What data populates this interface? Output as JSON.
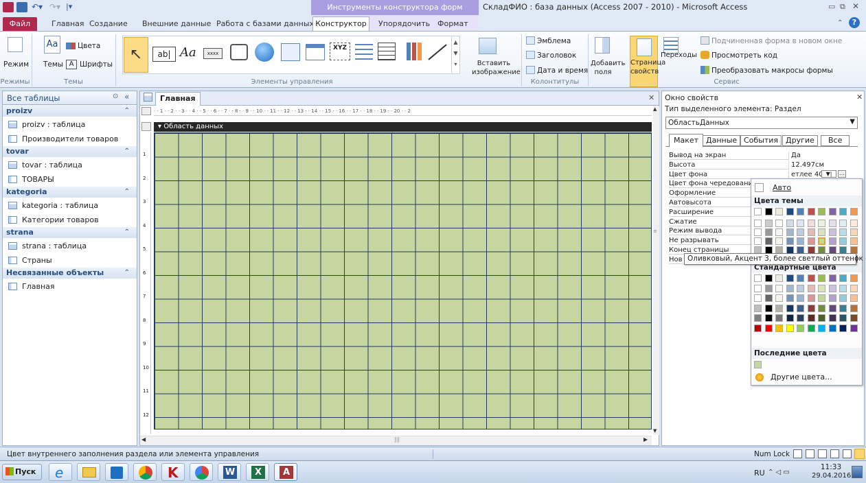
{
  "window": {
    "context_title": "Инструменты конструктора форм",
    "title": "СкладФИО : база данных (Access 2007 - 2010)  -  Microsoft Access"
  },
  "tabs": {
    "file": "Файл",
    "items": [
      "Главная",
      "Создание",
      "Внешние данные",
      "Работа с базами данных"
    ],
    "active": "Конструктор",
    "ctx_items": [
      "Упорядочить",
      "Формат"
    ]
  },
  "ribbon": {
    "mode": "Режим",
    "themes": "Темы",
    "colors": "Цвета",
    "fonts": "Шрифты",
    "insert_image": "Вставить изображение",
    "emblem": "Эмблема",
    "header": "Заголовок",
    "datetime": "Дата и время",
    "add_fields": "Добавить поля",
    "prop_sheet": "Страница свойств",
    "transitions": "Переходы",
    "subform_new": "Подчиненная форма в новом окне",
    "view_code": "Просмотреть код",
    "convert_macros": "Преобразовать макросы формы",
    "groups": {
      "modes": "Режимы",
      "themes": "Темы",
      "controls": "Элементы управления",
      "header_footer": "Колонтитулы",
      "service": "Сервис"
    }
  },
  "nav": {
    "title": "Все таблицы",
    "groups": [
      {
        "name": "proizv",
        "items": [
          {
            "label": "proizv : таблица",
            "kind": "table"
          },
          {
            "label": "Производители товаров",
            "kind": "form"
          }
        ]
      },
      {
        "name": "tovar",
        "items": [
          {
            "label": "tovar : таблица",
            "kind": "table"
          },
          {
            "label": "ТОВАРЫ",
            "kind": "form"
          }
        ]
      },
      {
        "name": "kategoria",
        "items": [
          {
            "label": "kategoria : таблица",
            "kind": "table"
          },
          {
            "label": "Категории товаров",
            "kind": "form"
          }
        ]
      },
      {
        "name": "strana",
        "items": [
          {
            "label": "strana : таблица",
            "kind": "table"
          },
          {
            "label": "Страны",
            "kind": "form"
          }
        ]
      },
      {
        "name": "Несвязанные объекты",
        "items": [
          {
            "label": "Главная",
            "kind": "form"
          }
        ]
      }
    ]
  },
  "document": {
    "tab": "Главная",
    "section": "Область данных",
    "vruler": [
      "1",
      "2",
      "3",
      "4",
      "5",
      "6",
      "7",
      "8",
      "9",
      "10",
      "11",
      "12"
    ],
    "hruler": "· · 1 · · 2 · · 3 · · 4 · · 5 · · 6 · · 7 · · 8 · · 9 · · 10 · · 11 · · 12 · · 13 · · 14 · · 15 · · 16 · · 17 · · 18 · · 19 · · 20 · · 2",
    "fill": "#c5d6a0"
  },
  "props": {
    "title": "Окно свойств",
    "selection_type": "Тип выделенного элемента:  Раздел",
    "object": "ОбластьДанных",
    "tabs": [
      "Макет",
      "Данные",
      "События",
      "Другие",
      "Все"
    ],
    "rows": [
      {
        "name": "Вывод на экран",
        "value": "Да"
      },
      {
        "name": "Высота",
        "value": "12.497см"
      },
      {
        "name": "Цвет фона",
        "value": "етлее 40%"
      },
      {
        "name": "Цвет фона чередования",
        "value": ""
      },
      {
        "name": "Оформление",
        "value": ""
      },
      {
        "name": "Автовысота",
        "value": ""
      },
      {
        "name": "Расширение",
        "value": ""
      },
      {
        "name": "Сжатие",
        "value": ""
      },
      {
        "name": "Режим вывода",
        "value": ""
      },
      {
        "name": "Не разрывать",
        "value": ""
      },
      {
        "name": "Конец страницы",
        "value": ""
      },
      {
        "name": "Нов",
        "value": ""
      }
    ]
  },
  "color_popup": {
    "auto": "Авто",
    "theme_colors": "Цвета темы",
    "standard_colors": "Стандартные цвета",
    "recent": "Последние цвета",
    "more": "Другие цвета...",
    "tooltip": "Оливковый, Акцент 3, более светлый оттенок 40%",
    "theme_base": [
      "#ffffff",
      "#000000",
      "#eeece1",
      "#1f497d",
      "#4f81bd",
      "#c0504d",
      "#9bbb59",
      "#8064a2",
      "#4bacc6",
      "#f79646"
    ],
    "recent_color": "#c5d6a0",
    "standard": [
      "#c00000",
      "#ff0000",
      "#ffc000",
      "#ffff00",
      "#92d050",
      "#00b050",
      "#00b0f0",
      "#0070c0",
      "#002060",
      "#7030a0"
    ]
  },
  "status": {
    "text": "Цвет внутреннего заполнения раздела или элемента управления",
    "numlock": "Num Lock"
  },
  "taskbar": {
    "start": "Пуск",
    "lang": "RU",
    "time": "11:33",
    "date": "29.04.2016"
  }
}
